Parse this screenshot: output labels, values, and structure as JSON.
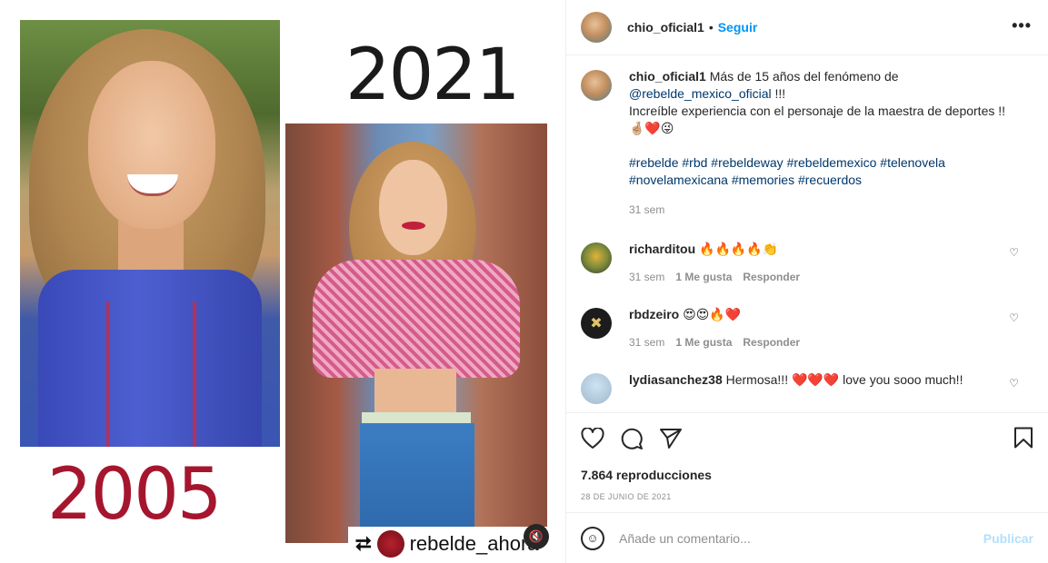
{
  "media": {
    "year_left": "2005",
    "year_right": "2021",
    "repost_icon": "repost-icon",
    "repost_handle": "rebelde_ahora",
    "mute_icon": "speaker-muted-icon"
  },
  "post": {
    "username": "chio_oficial1",
    "dot": "•",
    "follow_label": "Seguir",
    "more_label": "•••",
    "caption_user": "chio_oficial1",
    "caption_line1": "Más de 15 años del fenómeno de",
    "caption_mention": "@rebelde_mexico_oficial",
    "caption_after_mention": " !!!",
    "caption_line2": "Increíble experiencia con el personaje de la maestra de deportes !!",
    "caption_emojis": "🤞🏼❤️😜",
    "hashtags_line1": "#rebelde #rbd #rebeldeway #rebeldemexico #telenovela",
    "hashtags_line2": "#novelamexicana #memories #recuerdos",
    "caption_time": "31 sem"
  },
  "comments": [
    {
      "user": "richarditou",
      "text": "🔥🔥🔥🔥👏",
      "time": "31 sem",
      "likes": "1 Me gusta",
      "reply": "Responder"
    },
    {
      "user": "rbdzeiro",
      "text": "😍😍🔥❤️",
      "time": "31 sem",
      "likes": "1 Me gusta",
      "reply": "Responder"
    },
    {
      "user": "lydiasanchez38",
      "text": "Hermosa!!! ❤️❤️❤️ love you sooo much!!"
    }
  ],
  "stats": {
    "views": "7.864 reproducciones",
    "date": "28 DE JUNIO DE 2021"
  },
  "composer": {
    "placeholder": "Añade un comentario...",
    "post_label": "Publicar"
  }
}
